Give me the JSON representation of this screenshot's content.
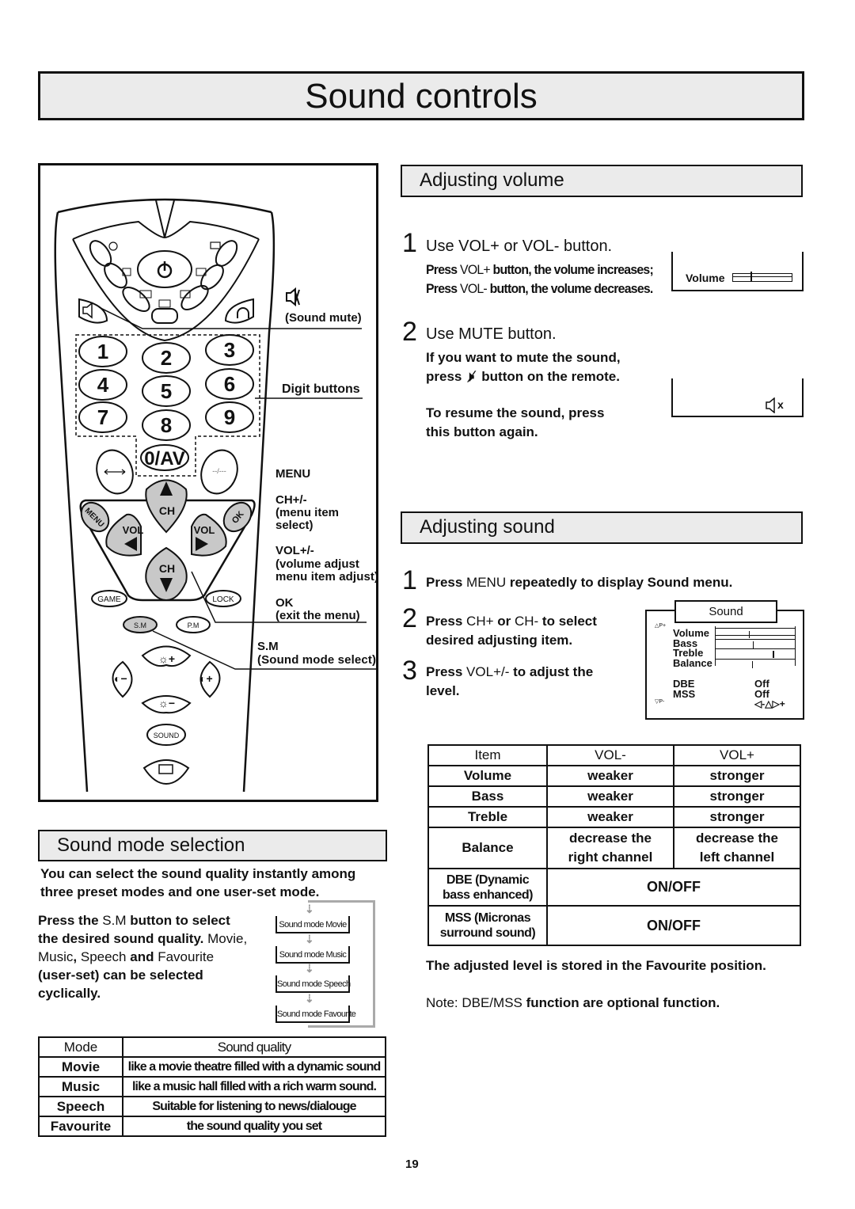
{
  "page_title": "Sound controls",
  "remote": {
    "digits": [
      "1",
      "2",
      "3",
      "4",
      "5",
      "6",
      "7",
      "8",
      "9"
    ],
    "zero_av": "0/AV",
    "dash": "--/---",
    "ch": "CH",
    "vol": "VOL",
    "menu": "MENU",
    "ok": "OK",
    "game": "GAME",
    "lock": "LOCK",
    "sm": "S.M",
    "pm": "P.M",
    "sound": "SOUND",
    "labels": {
      "sound_mute": "(Sound mute)",
      "digit_buttons": "Digit buttons",
      "menu": "MENU",
      "ch": "CH+/-",
      "ch_desc1": "(menu item",
      "ch_desc2": "select)",
      "vol": "VOL+/-",
      "vol_desc1": "(volume adjust",
      "vol_desc2": "menu item adjust)",
      "ok": "OK",
      "ok_desc": "(exit the menu)",
      "sm": "S.M",
      "sm_desc": "(Sound mode select)"
    }
  },
  "adjust_volume": {
    "header": "Adjusting volume",
    "step1_num": "1",
    "step1": "Use VOL+ or VOL- button.",
    "line1": [
      "Press ",
      "VOL+",
      " button, the volume increases;"
    ],
    "line2": [
      "Press ",
      "VOL-",
      " button, the volume decreases."
    ],
    "osd_volume_label": "Volume",
    "osd_volume_level": 0.3,
    "step2_num": "2",
    "step2": "Use MUTE button.",
    "mute1": "If you want to mute the sound,",
    "mute2a": "press",
    "mute2b": "button on the remote.",
    "resume1": "To resume the sound, press",
    "resume2": "this button again.",
    "mute_osd": "x"
  },
  "adjust_sound": {
    "header": "Adjusting sound",
    "s1_num": "1",
    "s1": [
      "Press ",
      "MENU",
      " repeatedly to display Sound menu."
    ],
    "s2_num": "2",
    "s2a": [
      "Press ",
      "CH+",
      " or ",
      "CH-",
      " to select"
    ],
    "s2b": "desired adjusting item.",
    "s3_num": "3",
    "s3a": [
      "Press ",
      "VOL+/-",
      " to adjust the"
    ],
    "s3b": "level.",
    "menu": {
      "title": "Sound",
      "p_up": "P+",
      "p_down": "P-",
      "items": [
        {
          "label": "Volume",
          "level": 0.42
        },
        {
          "label": "Bass",
          "level": 0.47
        },
        {
          "label": "Treble",
          "level": 0.72
        },
        {
          "label": "Balance",
          "level": 0.46
        }
      ],
      "dbe": "DBE",
      "dbe_val": "Off",
      "mss": "MSS",
      "mss_val": "Off",
      "minus": "-",
      "plus": "+"
    },
    "table": {
      "headers": [
        "Item",
        "VOL-",
        "VOL+"
      ],
      "rows": [
        [
          "Volume",
          "weaker",
          "stronger"
        ],
        [
          "Bass",
          "weaker",
          "stronger"
        ],
        [
          "Treble",
          "weaker",
          "stronger"
        ]
      ],
      "balance": [
        "Balance",
        "decrease the",
        "right channel",
        "decrease the",
        "left channel"
      ],
      "dbe": [
        "DBE (Dynamic",
        "bass enhanced)",
        "ON/OFF"
      ],
      "mss": [
        "MSS (Micronas",
        "surround sound)",
        "ON/OFF"
      ]
    },
    "stored": "The adjusted level is stored in the Favourite position.",
    "note": [
      "Note: DBE/MSS ",
      "function are optional function."
    ]
  },
  "sound_mode": {
    "header": "Sound mode selection",
    "intro1": "You can select the sound quality instantly among",
    "intro2": "three preset modes and one user-set mode.",
    "press": [
      "Press the ",
      "S.M",
      " button to select"
    ],
    "desired": [
      "the desired sound quality. ",
      "Movie,"
    ],
    "modes_line": [
      "Music",
      ", ",
      "Speech",
      " and ",
      "Favourite"
    ],
    "userset": "(user-set) can be selected",
    "cyclic": "cyclically.",
    "flow": [
      "Sound mode Movie",
      "Sound mode Music",
      "Sound mode Speech",
      "Sound mode Favourite"
    ],
    "table": {
      "headers": [
        "Mode",
        "Sound quality"
      ],
      "rows": [
        [
          "Movie",
          "like a movie theatre filled with a dynamic sound"
        ],
        [
          "Music",
          "like a music hall filled with a rich warm sound."
        ],
        [
          "Speech",
          "Suitable for listening to news/dialouge"
        ],
        [
          "Favourite",
          "the sound quality you set"
        ]
      ]
    }
  },
  "page_number": "19"
}
